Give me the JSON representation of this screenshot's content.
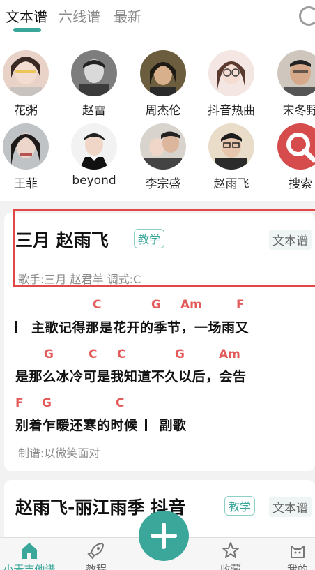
{
  "tabs": [
    {
      "label": "文本谱",
      "active": true
    },
    {
      "label": "六线谱",
      "active": false
    },
    {
      "label": "最新",
      "active": false
    }
  ],
  "artists": [
    {
      "name": "花粥",
      "icon": "avatar-photo"
    },
    {
      "name": "赵雷",
      "icon": "avatar-photo"
    },
    {
      "name": "周杰伦",
      "icon": "avatar-photo"
    },
    {
      "name": "抖音热曲",
      "icon": "avatar-photo"
    },
    {
      "name": "宋冬野",
      "icon": "avatar-photo"
    },
    {
      "name": "王菲",
      "icon": "avatar-photo"
    },
    {
      "name": "beyond",
      "icon": "avatar-photo"
    },
    {
      "name": "李宗盛",
      "icon": "avatar-photo"
    },
    {
      "name": "赵雨飞",
      "icon": "avatar-photo"
    },
    {
      "name": "搜索",
      "icon": "search-icon"
    }
  ],
  "songs": [
    {
      "title": "三月 赵雨飞",
      "edu_tag": "教学",
      "type_tag": "文本谱",
      "singer_line": "歌手:三月 赵君羊  调式:C",
      "chords": [
        [
          "C",
          "G",
          "Am",
          "F"
        ],
        [
          "G",
          "C",
          "C",
          "G",
          "Am"
        ],
        [
          "F",
          "G",
          "C"
        ]
      ],
      "lyrics": [
        "主歌记得那是花开的季节，一场雨又",
        "是那么冰冷可是我知道不久以后，会告",
        "别着乍暖还寒的时候",
        "副歌"
      ],
      "maker": "制谱:以微笑面对"
    },
    {
      "title": "赵雨飞-丽江雨季 抖音",
      "edu_tag": "教学",
      "type_tag": "文本谱"
    }
  ],
  "bottom_nav": [
    {
      "label": "小麦吉他谱",
      "icon": "home-icon",
      "active": true
    },
    {
      "label": "教程",
      "icon": "rocket-icon",
      "active": false
    },
    {
      "label": "收藏",
      "icon": "star-icon",
      "active": false
    },
    {
      "label": "我的",
      "icon": "cat-icon",
      "active": false
    }
  ],
  "colors": {
    "accent": "#3aa79a",
    "chord": "#e25a5a",
    "highlight_box": "#e24848"
  }
}
